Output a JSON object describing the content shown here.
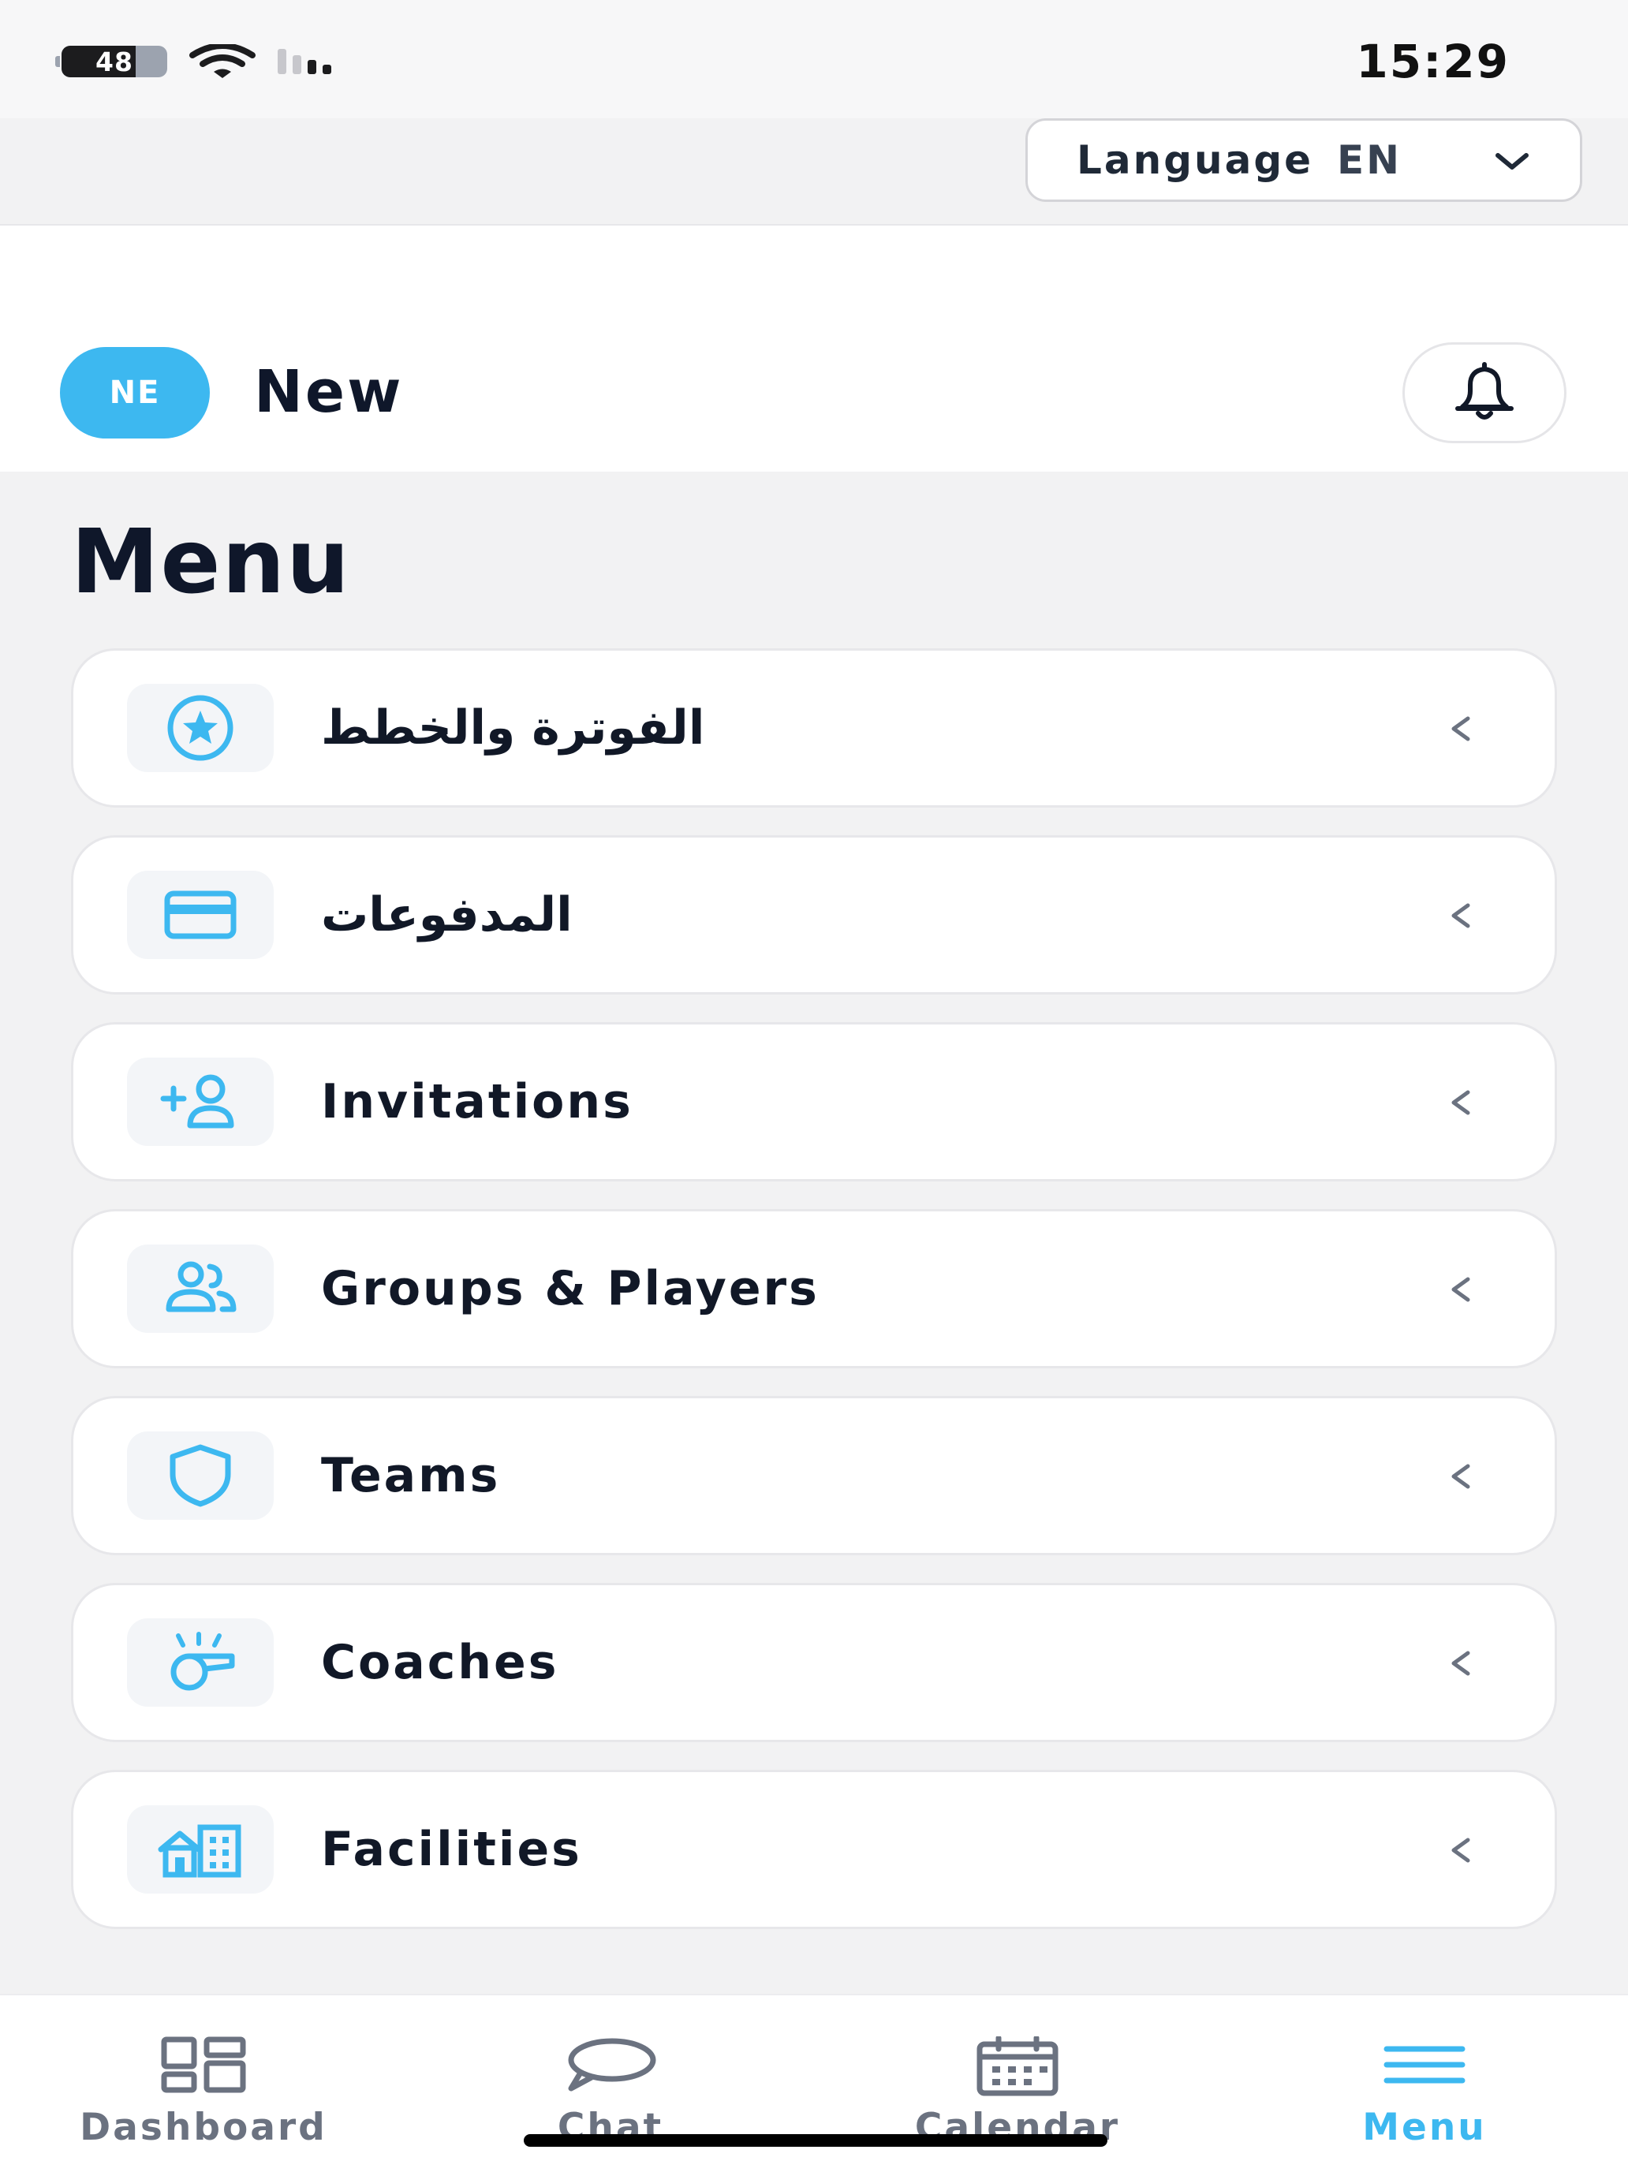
{
  "status_bar": {
    "battery": "48",
    "time": "15:29"
  },
  "language_select": {
    "label": "Language",
    "value": "EN"
  },
  "header": {
    "avatar_initials": "NE",
    "user_name": "New"
  },
  "menu": {
    "title": "Menu",
    "items": [
      {
        "label": "الفوترة والخطط",
        "icon": "star-badge-icon"
      },
      {
        "label": "المدفوعات",
        "icon": "credit-card-icon"
      },
      {
        "label": "Invitations",
        "icon": "add-user-icon"
      },
      {
        "label": "Groups & Players",
        "icon": "users-icon"
      },
      {
        "label": "Teams",
        "icon": "shield-icon"
      },
      {
        "label": "Coaches",
        "icon": "whistle-icon"
      },
      {
        "label": "Facilities",
        "icon": "buildings-icon"
      }
    ]
  },
  "tab_bar": {
    "tabs": [
      {
        "label": "Dashboard",
        "icon": "dashboard-icon",
        "active": false
      },
      {
        "label": "Chat",
        "icon": "chat-bubble-icon",
        "active": false
      },
      {
        "label": "Calendar",
        "icon": "calendar-icon",
        "active": false
      },
      {
        "label": "Menu",
        "icon": "hamburger-icon",
        "active": true
      }
    ]
  },
  "colors": {
    "accent": "#3db8f0",
    "text": "#111827",
    "muted": "#6b7280",
    "background": "#f2f2f3"
  }
}
